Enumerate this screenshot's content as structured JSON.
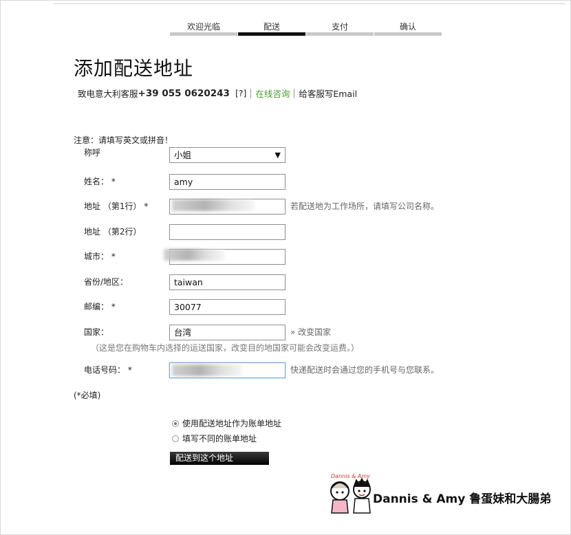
{
  "steps": [
    {
      "label": "欢迎光临",
      "active": false
    },
    {
      "label": "配送",
      "active": true
    },
    {
      "label": "支付",
      "active": false
    },
    {
      "label": "确认",
      "active": false
    }
  ],
  "page_title": "添加配送地址",
  "contact": {
    "prefix": "致电意大利客服",
    "phone": "+39 055 0620243",
    "help": "[?]",
    "chat": "在线咨询",
    "email": "给客服写Email"
  },
  "notice": "注意：请填写英文或拼音！",
  "form": {
    "salutation_label": "称呼",
    "salutation_value": "小姐",
    "name_label": "姓名：  *",
    "name_value": "amy",
    "address1_label": "地址 （第1行） *",
    "address1_hint": "若配送地为工作场所，请填写公司名称。",
    "address2_label": "地址 （第2行）",
    "city_label": "城市：  *",
    "province_label": "省份/地区：",
    "province_value": "taiwan",
    "zip_label": "邮编：  *",
    "zip_value": "30077",
    "country_label": "国家：",
    "country_value": "台湾",
    "country_change": "» 改变国家",
    "country_note": "（这是您在购物车内选择的运送国家，改变目的地国家可能会改变运费。）",
    "phone_label": "电话号码：  *",
    "phone_hint": "快递配送时会通过您的手机号与您联系。",
    "required_note": "(*必填)"
  },
  "billing": {
    "option_same": "使用配送地址作为账单地址",
    "option_other": "填写不同的账单地址",
    "selected": "same"
  },
  "submit_label": "配送到这个地址",
  "watermark": {
    "badge": "Dannis & Amy",
    "text": "Dannis & Amy 鲁蛋妹和大腸弟"
  }
}
